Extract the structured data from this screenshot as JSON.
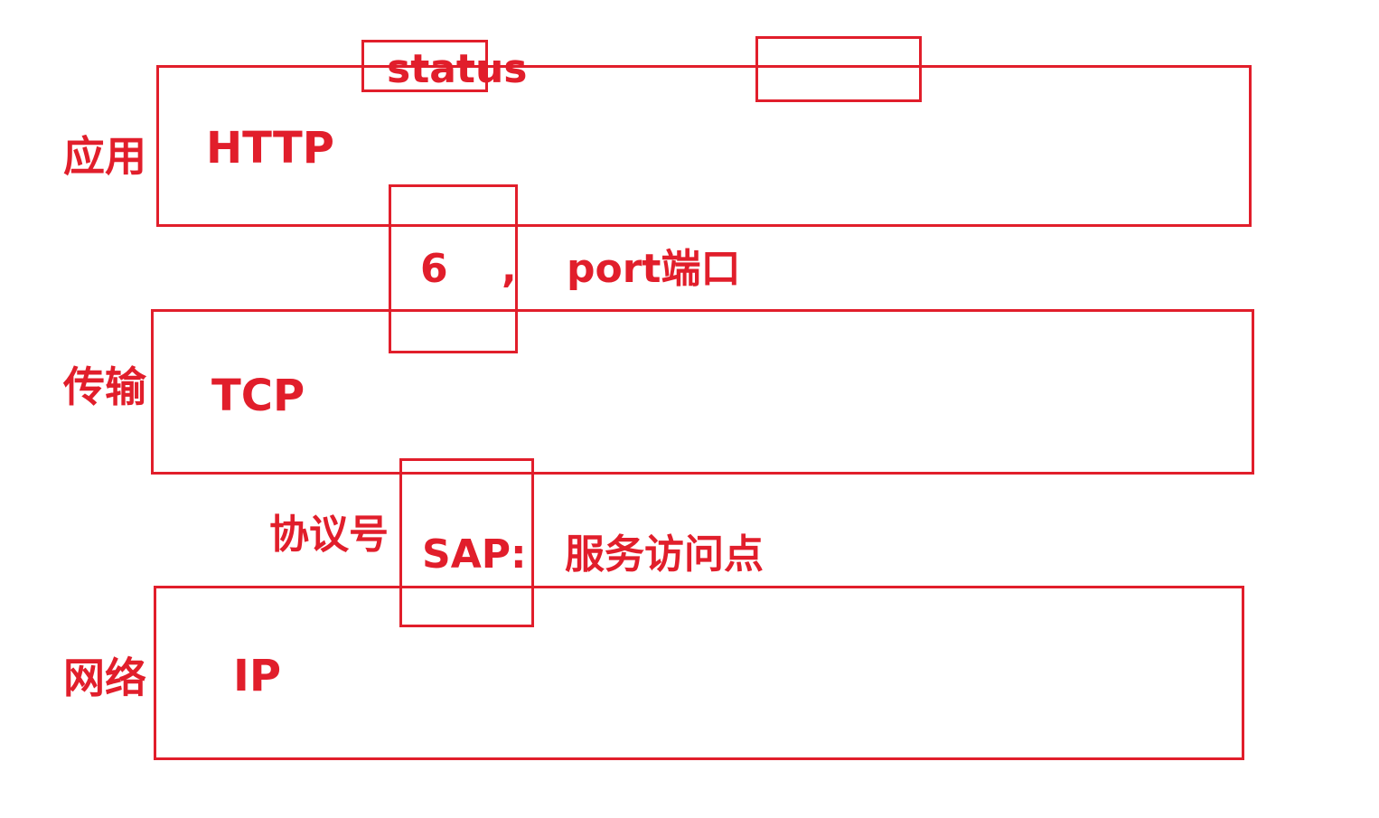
{
  "colors": {
    "ink": "#e11e2b"
  },
  "layers": {
    "application": {
      "label": "应用",
      "protocol": "HTTP"
    },
    "transport": {
      "label": "传输",
      "protocol": "TCP"
    },
    "network": {
      "label": "网络",
      "protocol": "IP"
    }
  },
  "annotations": {
    "status": "status",
    "proto_number": "6",
    "comma": ",",
    "port": "port端口",
    "protocol_number_label": "协议号",
    "sap": "SAP:",
    "sap_meaning": "服务访问点"
  }
}
